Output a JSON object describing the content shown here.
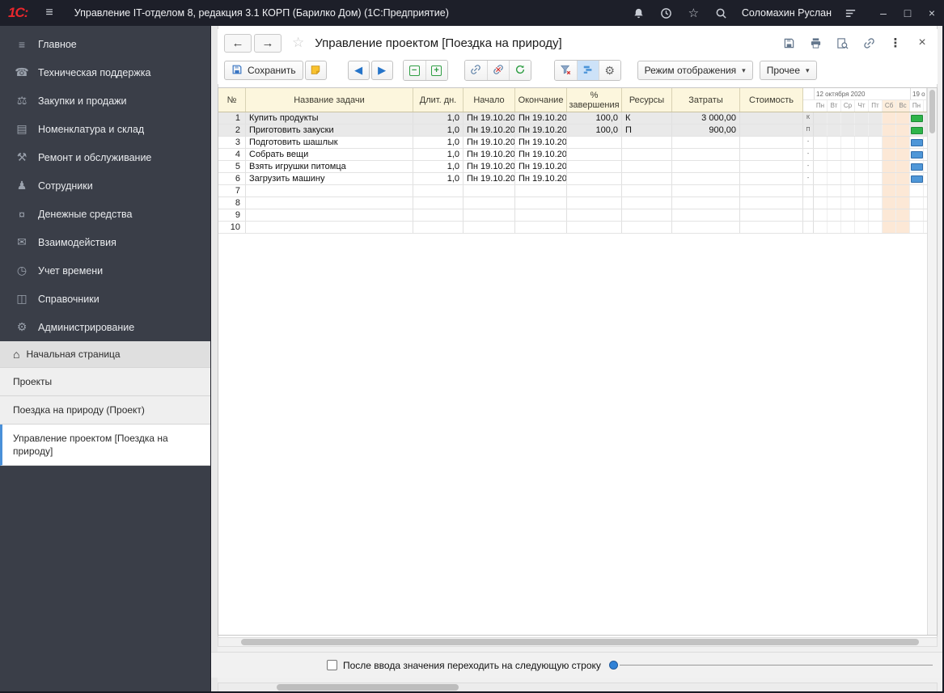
{
  "titlebar": {
    "logo": "1С:",
    "menu_glyph": "≡",
    "title": "Управление IT-отделом 8, редакция 3.1 КОРП (Барилко Дом)  (1С:Предприятие)",
    "user": "Соломахин Руслан",
    "minimize": "–",
    "maximize": "□",
    "close": "×"
  },
  "sidebar": {
    "sections": [
      {
        "name": "main",
        "glyph": "≡",
        "label": "Главное"
      },
      {
        "name": "tech-support",
        "glyph": "☎",
        "label": "Техническая поддержка"
      },
      {
        "name": "purchases-sales",
        "glyph": "⚖",
        "label": "Закупки и продажи"
      },
      {
        "name": "nomenclature-warehouse",
        "glyph": "▤",
        "label": "Номенклатура и склад"
      },
      {
        "name": "repair-service",
        "glyph": "⚒",
        "label": "Ремонт и обслуживание"
      },
      {
        "name": "employees",
        "glyph": "♟",
        "label": "Сотрудники"
      },
      {
        "name": "money",
        "glyph": "¤",
        "label": "Денежные средства"
      },
      {
        "name": "interactions",
        "glyph": "✉",
        "label": "Взаимодействия"
      },
      {
        "name": "time-tracking",
        "glyph": "◷",
        "label": "Учет времени"
      },
      {
        "name": "catalogs",
        "glyph": "◫",
        "label": "Справочники"
      },
      {
        "name": "administration",
        "glyph": "⚙",
        "label": "Администрирование"
      }
    ],
    "pages": [
      {
        "label": "Начальная страница",
        "home": true
      },
      {
        "label": "Проекты"
      },
      {
        "label": "Поездка на природу (Проект)"
      },
      {
        "label": "Управление проектом [Поездка на природу]",
        "active": true
      }
    ]
  },
  "window": {
    "back": "←",
    "forward": "→",
    "favorite": "☆",
    "title": "Управление проектом [Поездка на природу]",
    "kebab": "⋮",
    "close": "×"
  },
  "toolbar": {
    "save": "Сохранить",
    "left_arrow": "◀",
    "right_arrow": "▶",
    "collapse": "−",
    "expand": "+",
    "gear": "⚙",
    "display_mode": "Режим отображения",
    "more": "Прочее",
    "caret": "▾"
  },
  "table": {
    "columns": [
      "№",
      "Название задачи",
      "Длит. дн.",
      "Начало",
      "Окончание",
      "% завершения",
      "Ресурсы",
      "Затраты",
      "Стоимость"
    ],
    "rows": [
      {
        "n": "1",
        "task": "Купить продукты",
        "dur": "1,0",
        "start": "Пн 19.10.20",
        "end": "Пн 19.10.20",
        "pct": "100,0",
        "res": "К",
        "cost": "3 000,00",
        "price": "",
        "done": true
      },
      {
        "n": "2",
        "task": "Приготовить закуски",
        "dur": "1,0",
        "start": "Пн 19.10.20",
        "end": "Пн 19.10.20",
        "pct": "100,0",
        "res": "П",
        "cost": "900,00",
        "price": "",
        "done": true
      },
      {
        "n": "3",
        "task": "Подготовить шашлык",
        "dur": "1,0",
        "start": "Пн 19.10.20",
        "end": "Пн 19.10.20",
        "pct": "",
        "res": "",
        "cost": "",
        "price": ""
      },
      {
        "n": "4",
        "task": "Собрать вещи",
        "dur": "1,0",
        "start": "Пн 19.10.20",
        "end": "Пн 19.10.20",
        "pct": "",
        "res": "",
        "cost": "",
        "price": ""
      },
      {
        "n": "5",
        "task": "Взять игрушки питомца",
        "dur": "1,0",
        "start": "Пн 19.10.20",
        "end": "Пн 19.10.20",
        "pct": "",
        "res": "",
        "cost": "",
        "price": ""
      },
      {
        "n": "6",
        "task": "Загрузить машину",
        "dur": "1,0",
        "start": "Пн 19.10.20",
        "end": "Пн 19.10.20",
        "pct": "",
        "res": "",
        "cost": "",
        "price": ""
      },
      {
        "n": "7"
      },
      {
        "n": "8"
      },
      {
        "n": "9"
      },
      {
        "n": "10"
      }
    ]
  },
  "gantt": {
    "week1_label": "12 октября 2020",
    "week2_label": "19 о",
    "days": [
      "Пн",
      "Вт",
      "Ср",
      "Чт",
      "Пт",
      "Сб",
      "Вс",
      "Пн"
    ],
    "weekend_day_indexes": [
      5,
      6
    ],
    "row_markers": [
      "К",
      "П",
      "-",
      "-",
      "-",
      "-",
      "",
      "",
      "",
      ""
    ],
    "bars": [
      {
        "row": 0,
        "day": 7,
        "color": "green"
      },
      {
        "row": 1,
        "day": 7,
        "color": "green"
      },
      {
        "row": 2,
        "day": 7,
        "color": "blue"
      },
      {
        "row": 3,
        "day": 7,
        "color": "blue"
      },
      {
        "row": 4,
        "day": 7,
        "color": "blue"
      },
      {
        "row": 5,
        "day": 7,
        "color": "blue"
      }
    ],
    "colors": {
      "green": "#2eb44a",
      "blue": "#4f97d8",
      "weekend": "#fce8d6"
    }
  },
  "footer": {
    "checkbox_label": "После ввода значения переходить на следующую строку",
    "checkbox_checked": false
  }
}
